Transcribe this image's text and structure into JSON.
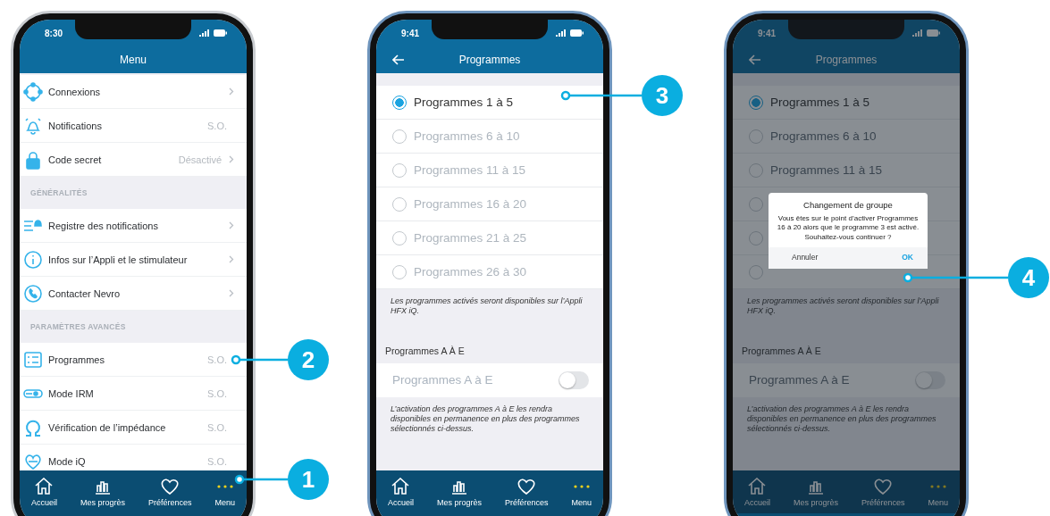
{
  "phones": [
    {
      "kind": "menu",
      "time": "8:30",
      "title": "Menu",
      "sections": [
        {
          "rows": [
            {
              "label": "Connexions",
              "chevron": true
            },
            {
              "label": "Notifications",
              "value": "S.O.",
              "chevron": false
            },
            {
              "label": "Code secret",
              "value": "Désactivé",
              "chevron": true
            }
          ]
        },
        {
          "header": "GÉNÉRALITÉS",
          "rows": [
            {
              "label": "Registre des notifications",
              "chevron": true
            },
            {
              "label": "Infos sur l’Appli et le stimulateur",
              "chevron": true
            },
            {
              "label": "Contacter Nevro",
              "chevron": true
            }
          ]
        },
        {
          "header": "PARAMÈTRES AVANCÉS",
          "rows": [
            {
              "label": "Programmes",
              "value": "S.O.",
              "chevron": false
            },
            {
              "label": "Mode IRM",
              "value": "S.O.",
              "chevron": false
            },
            {
              "label": "Vérification de l’impédance",
              "value": "S.O.",
              "chevron": false
            },
            {
              "label": "Mode iQ",
              "value": "S.O.",
              "chevron": false
            }
          ]
        }
      ],
      "tabs": [
        {
          "label": "Accueil",
          "selected": false
        },
        {
          "label": "Mes progrès",
          "selected": false
        },
        {
          "label": "Préférences",
          "selected": false
        },
        {
          "label": "Menu",
          "selected": true
        }
      ]
    },
    {
      "kind": "programs",
      "time": "9:41",
      "title": "Programmes",
      "radios": [
        {
          "label": "Programmes 1 à 5",
          "selected": true
        },
        {
          "label": "Programmes 6 à 10",
          "selected": false
        },
        {
          "label": "Programmes 11 à 15",
          "selected": false
        },
        {
          "label": "Programmes 16 à 20",
          "selected": false
        },
        {
          "label": "Programmes 21 à 25",
          "selected": false
        },
        {
          "label": "Programmes 26 à 30",
          "selected": false
        }
      ],
      "note": "Les programmes activés seront disponibles sur l’Appli HFX iQ.",
      "section_title": "Programmes A À E",
      "toggle_row": {
        "label": "Programmes A à E",
        "on": false,
        "disabled": true
      },
      "toggle_note": "L’activation des programmes A à E les rendra disponibles en permanence en plus des programmes sélectionnés ci-dessus.",
      "tabs": [
        {
          "label": "Accueil",
          "selected": false
        },
        {
          "label": "Mes progrès",
          "selected": false
        },
        {
          "label": "Préférences",
          "selected": false
        },
        {
          "label": "Menu",
          "selected": true
        }
      ]
    },
    {
      "kind": "programs",
      "time": "9:41",
      "title": "Programmes",
      "dimmed": true,
      "radios": [
        {
          "label": "Programmes 1 à 5",
          "selected": true
        },
        {
          "label": "Programmes 6 à 10",
          "selected": false
        },
        {
          "label": "Programmes 11 à 15",
          "selected": false
        },
        {
          "selected": false
        },
        {
          "selected": false
        },
        {
          "selected": false
        }
      ],
      "note": "Les programmes activés seront disponibles sur l’Appli HFX iQ.",
      "section_title": "Programmes A À E",
      "toggle_row": {
        "label": "Programmes A à E",
        "on": false,
        "disabled": true
      },
      "toggle_note": "L’activation des programmes A à E les rendra disponibles en permanence en plus des programmes sélectionnés ci-dessus.",
      "dialog": {
        "title": "Changement de groupe",
        "message": "Vous êtes sur le point d’activer Programmes 16 à 20 alors que le programme 3 est activé. Souhaitez-vous continuer ?",
        "buttons": [
          {
            "label": "Annuler",
            "kind": "cancel"
          },
          {
            "label": "OK",
            "kind": "confirm"
          }
        ]
      },
      "tabs": [
        {
          "label": "Accueil",
          "selected": false
        },
        {
          "label": "Mes progrès",
          "selected": false
        },
        {
          "label": "Préférences",
          "selected": false
        },
        {
          "label": "Menu",
          "selected": true
        }
      ]
    }
  ],
  "callouts": [
    {
      "number": "1"
    },
    {
      "number": "2"
    },
    {
      "number": "3"
    },
    {
      "number": "4"
    }
  ]
}
